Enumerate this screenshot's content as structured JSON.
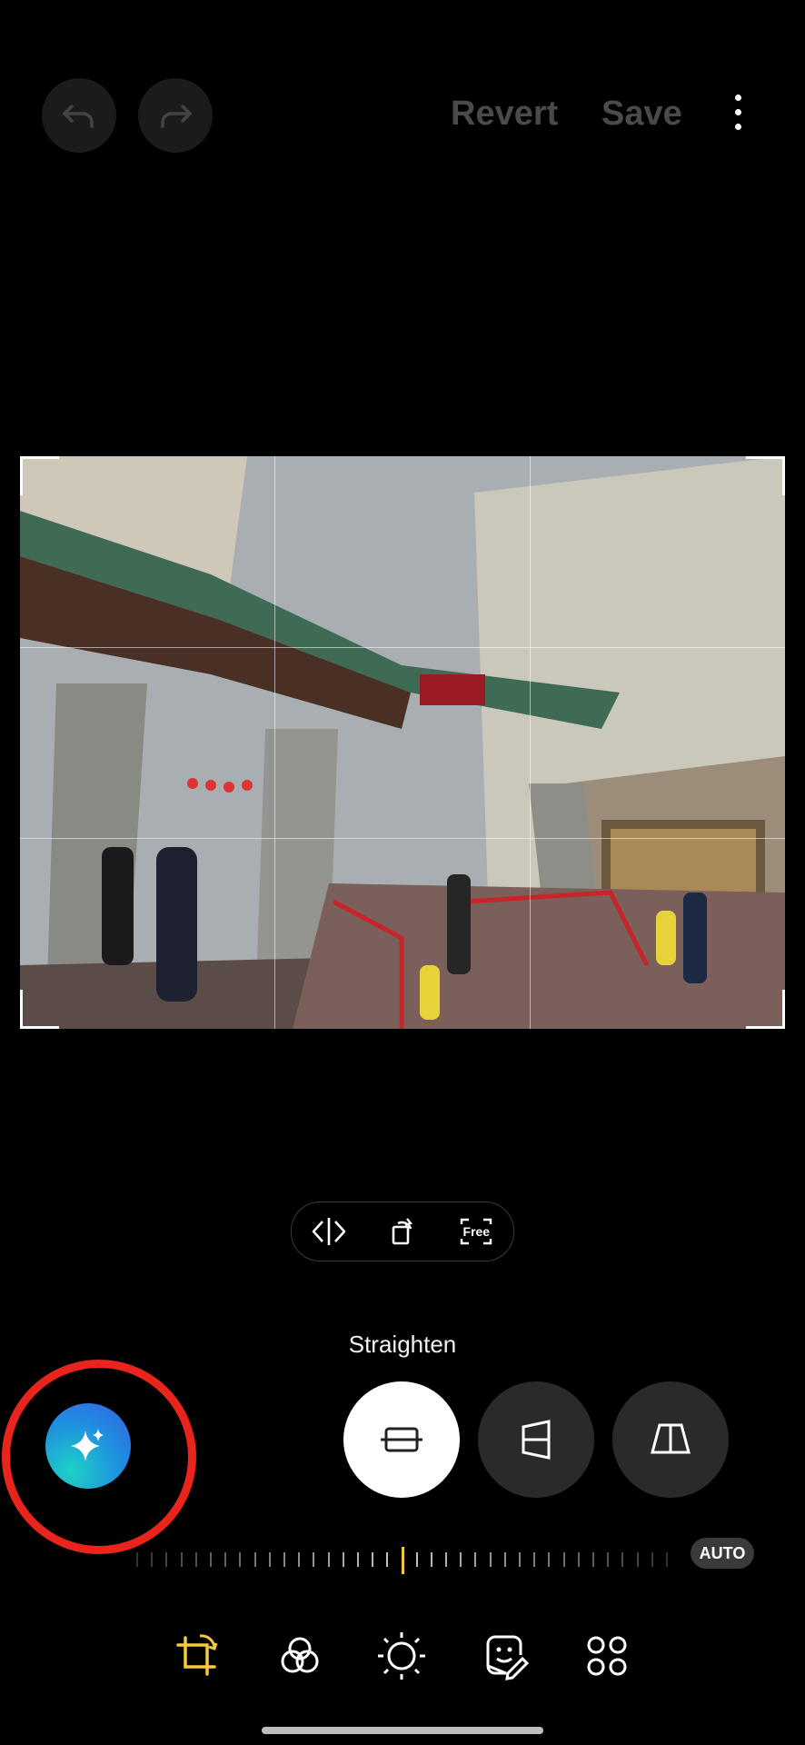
{
  "toolbar": {
    "undo_icon": "undo-icon",
    "redo_icon": "redo-icon",
    "revert_label": "Revert",
    "save_label": "Save",
    "more_icon": "more-vertical-icon"
  },
  "photo": {
    "description_icon": "photo-preview"
  },
  "tools": {
    "items": [
      {
        "icon": "flip-icon"
      },
      {
        "icon": "rotate-icon"
      },
      {
        "label": "Free",
        "icon": "free-aspect-icon"
      }
    ]
  },
  "adjust": {
    "mode_label": "Straighten",
    "modes": [
      "straighten",
      "vertical-perspective",
      "horizontal-perspective"
    ],
    "auto_label": "AUTO",
    "level": 0
  },
  "bottom_nav": {
    "items": [
      "crop-rotate",
      "filters",
      "tone",
      "decorations",
      "more-tools"
    ],
    "active": "crop-rotate",
    "accent": "#f5c842"
  },
  "colors": {
    "highlight_ring": "#e8241c",
    "ai_gradient_start": "#1dd1c4",
    "ai_gradient_end": "#3a5ee6"
  }
}
